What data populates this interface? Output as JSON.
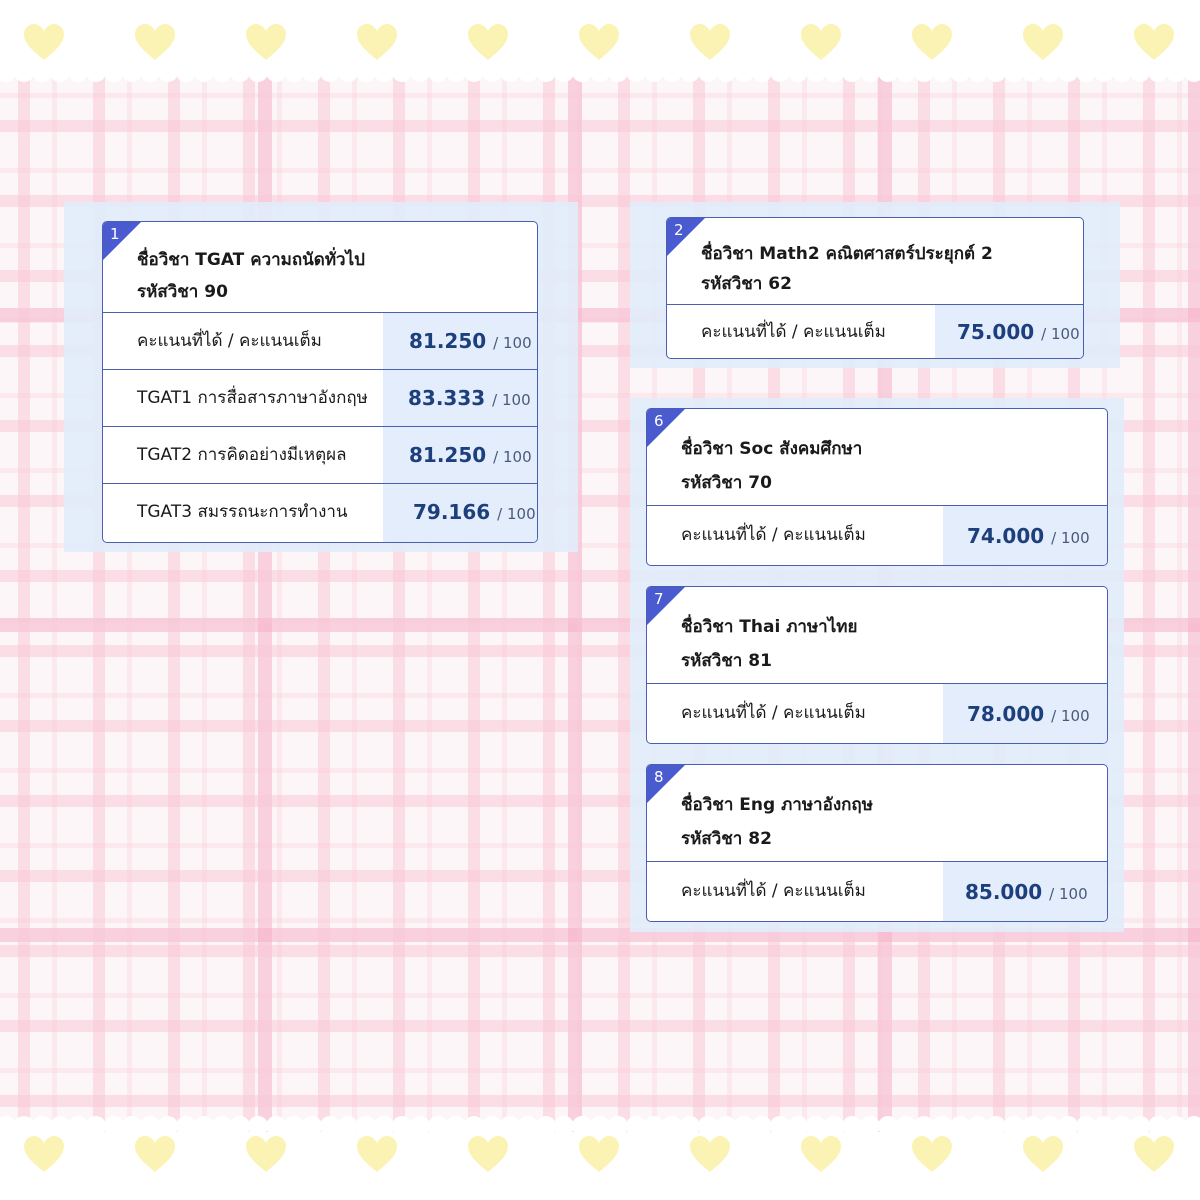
{
  "colors": {
    "accent": "#4a5bcf",
    "border": "#4b5fb0",
    "score_text": "#1d3f7c",
    "score_bg": "#e3edfc",
    "heart": "#fbf3b4",
    "plaid": "#f8c8d6"
  },
  "decor": {
    "heart_icon": "heart-icon"
  },
  "cards": [
    {
      "number": "1",
      "title": "ชื่อวิชา TGAT ความถนัดทั่วไป",
      "code": "รหัสวิชา 90",
      "rows": [
        {
          "label": "คะแนนที่ได้ / คะแนนเต็ม",
          "score": "81.250",
          "max": "/ 100"
        },
        {
          "label": "TGAT1 การสื่อสารภาษาอังกฤษ",
          "score": "83.333",
          "max": "/ 100"
        },
        {
          "label": "TGAT2 การคิดอย่างมีเหตุผล",
          "score": "81.250",
          "max": "/ 100"
        },
        {
          "label": "TGAT3 สมรรถนะการทำงาน",
          "score": "79.166",
          "max": "/ 100"
        }
      ]
    },
    {
      "number": "2",
      "title": "ชื่อวิชา Math2 คณิตศาสตร์ประยุกต์ 2",
      "code": "รหัสวิชา 62",
      "rows": [
        {
          "label": "คะแนนที่ได้ / คะแนนเต็ม",
          "score": "75.000",
          "max": "/ 100"
        }
      ]
    },
    {
      "number": "6",
      "title": "ชื่อวิชา Soc สังคมศึกษา",
      "code": "รหัสวิชา 70",
      "rows": [
        {
          "label": "คะแนนที่ได้ / คะแนนเต็ม",
          "score": "74.000",
          "max": "/ 100"
        }
      ]
    },
    {
      "number": "7",
      "title": "ชื่อวิชา Thai ภาษาไทย",
      "code": "รหัสวิชา 81",
      "rows": [
        {
          "label": "คะแนนที่ได้ / คะแนนเต็ม",
          "score": "78.000",
          "max": "/ 100"
        }
      ]
    },
    {
      "number": "8",
      "title": "ชื่อวิชา Eng ภาษาอังกฤษ",
      "code": "รหัสวิชา 82",
      "rows": [
        {
          "label": "คะแนนที่ได้ / คะแนนเต็ม",
          "score": "85.000",
          "max": "/ 100"
        }
      ]
    }
  ]
}
